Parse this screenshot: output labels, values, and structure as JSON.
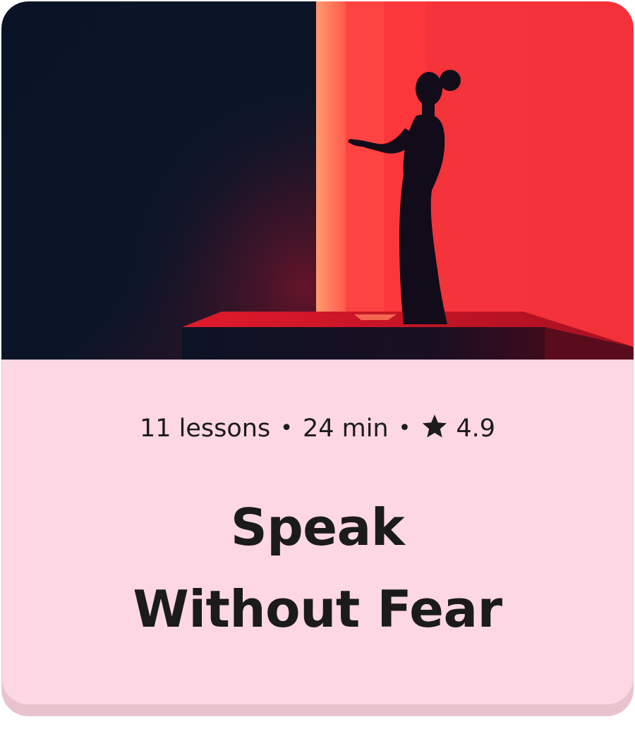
{
  "course": {
    "lessons_label": "11 lessons",
    "separator": "•",
    "duration_label": "24 min",
    "rating_icon": "star-icon",
    "rating_value": "4.9",
    "title_line_1": "Speak",
    "title_line_2": "Without Fear"
  },
  "colors": {
    "card_background": "#fdd7e3",
    "card_shadow": "#e8c3ce",
    "text": "#1c1c1c",
    "hero_dark": "#0a1428",
    "hero_red": "#f5333a"
  }
}
